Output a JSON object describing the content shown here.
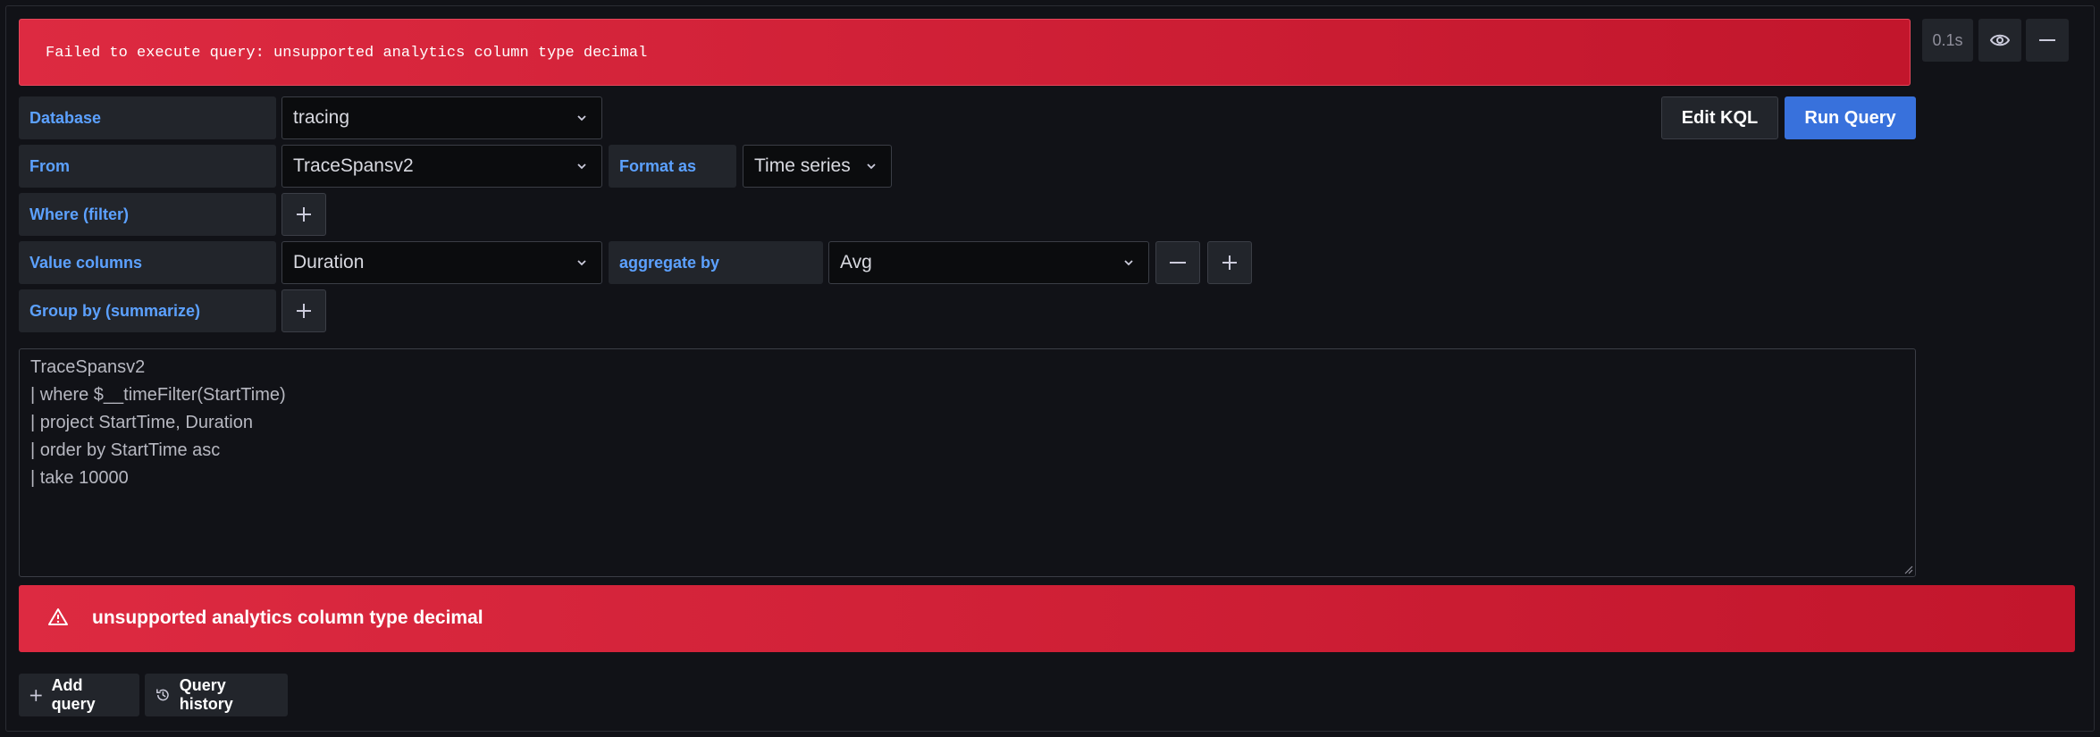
{
  "error_banner": {
    "message": "Failed to execute query: unsupported analytics column type decimal"
  },
  "toolbar": {
    "timing": "0.1s"
  },
  "actions": {
    "edit_kql": "Edit KQL",
    "run_query": "Run Query"
  },
  "rows": {
    "database": {
      "label": "Database",
      "value": "tracing"
    },
    "from": {
      "label": "From",
      "value": "TraceSpansv2"
    },
    "format": {
      "label": "Format as",
      "value": "Time series"
    },
    "where": {
      "label": "Where (filter)"
    },
    "value_columns": {
      "label": "Value columns",
      "value": "Duration"
    },
    "aggregate": {
      "label": "aggregate by",
      "value": "Avg"
    },
    "group_by": {
      "label": "Group by (summarize)"
    }
  },
  "editor": {
    "lines": [
      "TraceSpansv2",
      "| where $__timeFilter(StartTime)",
      "| project StartTime, Duration",
      "| order by StartTime asc",
      "| take 10000"
    ]
  },
  "query_error": {
    "message": "unsupported analytics column type decimal"
  },
  "footer": {
    "add_query": "Add query",
    "query_history": "Query history"
  },
  "colors": {
    "error": "#d82a40",
    "accent": "#5ca1ff",
    "primary": "#3871dc",
    "background": "#111217"
  }
}
